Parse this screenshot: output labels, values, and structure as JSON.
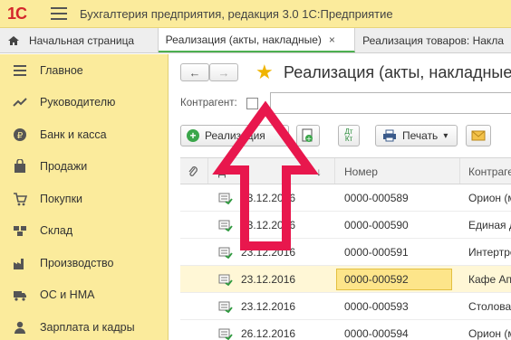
{
  "app": {
    "logo": "1С",
    "title": "Бухгалтерия предприятия, редакция 3.0 1С:Предприятие"
  },
  "tabs": [
    {
      "label": "Начальная страница"
    },
    {
      "label": "Реализация (акты, накладные)",
      "close": "×"
    },
    {
      "label": "Реализация товаров: Накла"
    }
  ],
  "sidebar": {
    "items": [
      {
        "label": "Главное",
        "icon": "menu-list-icon"
      },
      {
        "label": "Руководителю",
        "icon": "trend-icon"
      },
      {
        "label": "Банк и касса",
        "icon": "ruble-coin-icon"
      },
      {
        "label": "Продажи",
        "icon": "shopping-bag-icon"
      },
      {
        "label": "Покупки",
        "icon": "cart-icon"
      },
      {
        "label": "Склад",
        "icon": "warehouse-icon"
      },
      {
        "label": "Производство",
        "icon": "factory-icon"
      },
      {
        "label": "ОС и НМА",
        "icon": "truck-icon"
      },
      {
        "label": "Зарплата и кадры",
        "icon": "person-icon"
      }
    ]
  },
  "main": {
    "back": "←",
    "forward": "→",
    "star": "★",
    "title": "Реализация (акты, накладные",
    "filter_label": "Контрагент:",
    "create_label": "Реализация",
    "print_label": "Печать",
    "print_caret": "▾",
    "dt": "Дт",
    "kt": "Кт"
  },
  "table": {
    "headers": {
      "attach": "",
      "date": "Д",
      "sort": "↓",
      "number": "Номер",
      "counterparty": "Контраген"
    },
    "rows": [
      {
        "date": "23.12.2016",
        "number": "0000-000589",
        "counterparty": "Орион (м"
      },
      {
        "date": "23.12.2016",
        "number": "0000-000590",
        "counterparty": "Единая д"
      },
      {
        "date": "23.12.2016",
        "number": "0000-000591",
        "counterparty": "Интертрей"
      },
      {
        "date": "23.12.2016",
        "number": "0000-000592",
        "counterparty": "Кафе Апо",
        "selected": true
      },
      {
        "date": "23.12.2016",
        "number": "0000-000593",
        "counterparty": "Столовая"
      },
      {
        "date": "26.12.2016",
        "number": "0000-000594",
        "counterparty": "Орион (м"
      }
    ]
  },
  "colors": {
    "sidebar_bg": "#fbeb9c",
    "arrow": "#e8174d",
    "selection": "#fde58a",
    "accent_green": "#4caf50"
  }
}
